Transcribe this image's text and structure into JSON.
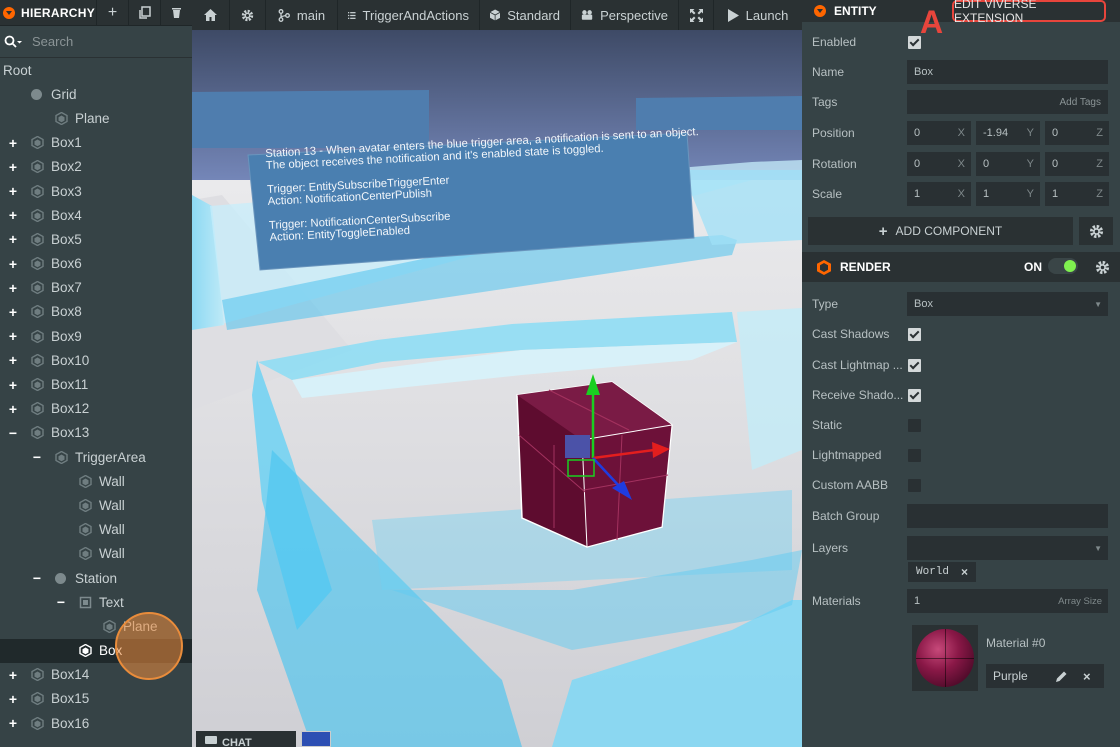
{
  "hierarchy": {
    "title": "HIERARCHY",
    "search_placeholder": "Search",
    "root": "Root",
    "items": [
      {
        "label": "Grid",
        "depth": 0,
        "icon": "dot",
        "exp": ""
      },
      {
        "label": "Plane",
        "depth": 1,
        "icon": "cube",
        "exp": ""
      },
      {
        "label": "Box1",
        "depth": 0,
        "icon": "cube",
        "exp": "+"
      },
      {
        "label": "Box2",
        "depth": 0,
        "icon": "cube",
        "exp": "+"
      },
      {
        "label": "Box3",
        "depth": 0,
        "icon": "cube",
        "exp": "+"
      },
      {
        "label": "Box4",
        "depth": 0,
        "icon": "cube",
        "exp": "+"
      },
      {
        "label": "Box5",
        "depth": 0,
        "icon": "cube",
        "exp": "+"
      },
      {
        "label": "Box6",
        "depth": 0,
        "icon": "cube",
        "exp": "+"
      },
      {
        "label": "Box7",
        "depth": 0,
        "icon": "cube",
        "exp": "+"
      },
      {
        "label": "Box8",
        "depth": 0,
        "icon": "cube",
        "exp": "+"
      },
      {
        "label": "Box9",
        "depth": 0,
        "icon": "cube",
        "exp": "+"
      },
      {
        "label": "Box10",
        "depth": 0,
        "icon": "cube",
        "exp": "+"
      },
      {
        "label": "Box11",
        "depth": 0,
        "icon": "cube",
        "exp": "+"
      },
      {
        "label": "Box12",
        "depth": 0,
        "icon": "cube",
        "exp": "+"
      },
      {
        "label": "Box13",
        "depth": 0,
        "icon": "cube",
        "exp": "−"
      },
      {
        "label": "TriggerArea",
        "depth": 1,
        "icon": "cube",
        "exp": "−"
      },
      {
        "label": "Wall",
        "depth": 2,
        "icon": "cube",
        "exp": ""
      },
      {
        "label": "Wall",
        "depth": 2,
        "icon": "cube",
        "exp": ""
      },
      {
        "label": "Wall",
        "depth": 2,
        "icon": "cube",
        "exp": ""
      },
      {
        "label": "Wall",
        "depth": 2,
        "icon": "cube",
        "exp": ""
      },
      {
        "label": "Station",
        "depth": 1,
        "icon": "dot",
        "exp": "−"
      },
      {
        "label": "Text",
        "depth": 2,
        "icon": "square",
        "exp": "−"
      },
      {
        "label": "Plane",
        "depth": 3,
        "icon": "cube",
        "exp": ""
      },
      {
        "label": "Box",
        "depth": 2,
        "icon": "cube",
        "exp": "",
        "selected": true
      },
      {
        "label": "Box14",
        "depth": 0,
        "icon": "cube",
        "exp": "+"
      },
      {
        "label": "Box15",
        "depth": 0,
        "icon": "cube",
        "exp": "+"
      },
      {
        "label": "Box16",
        "depth": 0,
        "icon": "cube",
        "exp": "+"
      }
    ]
  },
  "toolbar": {
    "branch": "main",
    "scene": "TriggerAndActions",
    "material_mode": "Standard",
    "camera": "Perspective",
    "launch": "Launch"
  },
  "viewport": {
    "sign_lines": [
      "Station 13 - When avatar enters the blue trigger area, a notification is sent to an object.",
      "The object receives the notification and it's enabled state is toggled.",
      "",
      "Trigger: EntitySubscribeTriggerEnter",
      "Action: NotificationCenterPublish",
      "",
      "Trigger: NotificationCenterSubscribe",
      "Action: EntityToggleEnabled"
    ],
    "chat_label": "CHAT"
  },
  "inspector": {
    "entity_title": "ENTITY",
    "edit_extension": "EDIT VIVERSE EXTENSION",
    "annotation": "A",
    "enabled_label": "Enabled",
    "name_label": "Name",
    "name_value": "Box",
    "tags_label": "Tags",
    "tags_placeholder": "Add Tags",
    "position_label": "Position",
    "position": [
      "0",
      "-1.94",
      "0"
    ],
    "rotation_label": "Rotation",
    "rotation": [
      "0",
      "0",
      "0"
    ],
    "scale_label": "Scale",
    "scale": [
      "1",
      "1",
      "1"
    ],
    "axes": [
      "X",
      "Y",
      "Z"
    ],
    "add_component": "ADD COMPONENT",
    "render_title": "RENDER",
    "render_state": "ON",
    "type_label": "Type",
    "type_value": "Box",
    "cast_shadows": "Cast Shadows",
    "cast_lightmap": "Cast Lightmap ...",
    "receive_shadows": "Receive Shado...",
    "static": "Static",
    "lightmapped": "Lightmapped",
    "custom_aabb": "Custom AABB",
    "batch_group": "Batch Group",
    "layers": "Layers",
    "layer_tag": "World",
    "materials": "Materials",
    "materials_count": "1",
    "array_size": "Array Size",
    "material_slot": "Material #0",
    "material_name": "Purple"
  },
  "colors": {
    "accent": "#ff6600",
    "annotation": "#e8453c",
    "toggle_on": "#7ff04f",
    "material": "#8a1847"
  }
}
